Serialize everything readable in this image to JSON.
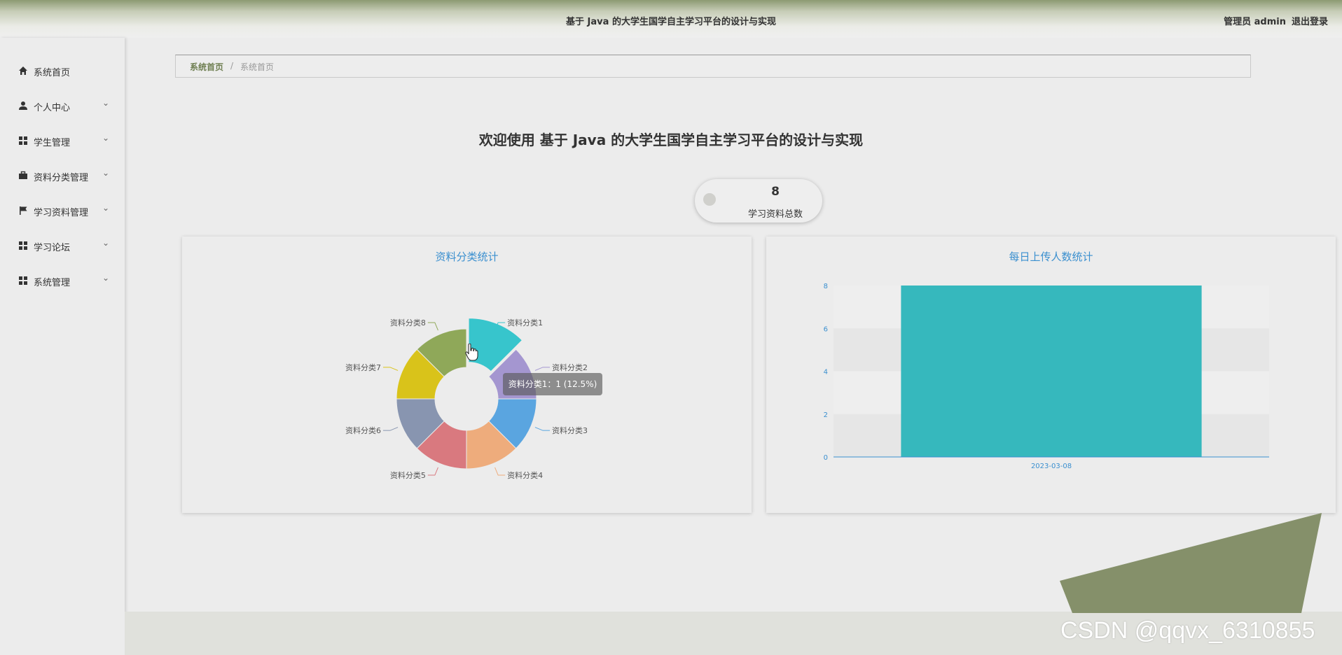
{
  "header": {
    "title": "基于 Java 的大学生国学自主学习平台的设计与实现",
    "user": "管理员 admin",
    "logout": "退出登录"
  },
  "sidebar": {
    "items": [
      {
        "label": "系统首页",
        "icon": "home-icon"
      },
      {
        "label": "个人中心",
        "icon": "user-icon"
      },
      {
        "label": "学生管理",
        "icon": "grid-icon"
      },
      {
        "label": "资料分类管理",
        "icon": "briefcase-icon"
      },
      {
        "label": "学习资料管理",
        "icon": "flag-icon"
      },
      {
        "label": "学习论坛",
        "icon": "grid-icon"
      },
      {
        "label": "系统管理",
        "icon": "grid-icon"
      }
    ]
  },
  "breadcrumb": {
    "home": "系统首页",
    "separator": "/",
    "current": "系统首页"
  },
  "welcome": "欢迎使用 基于 Java 的大学生国学自主学习平台的设计与实现",
  "stat": {
    "value": "8",
    "label": "学习资料总数"
  },
  "pie_panel": {
    "title": "资料分类统计"
  },
  "bar_panel": {
    "title": "每日上传人数统计"
  },
  "tooltip": "资料分类1：1 (12.5%)",
  "watermark": "CSDN @qqvx_6310855",
  "colors": {
    "accent": "#6f7f52",
    "title_blue": "#3a8fcf",
    "bar": "#36b8bd"
  },
  "chart_data": [
    {
      "type": "pie",
      "title": "资料分类统计",
      "donut": true,
      "categories": [
        "资料分类1",
        "资料分类2",
        "资料分类3",
        "资料分类4",
        "资料分类5",
        "资料分类6",
        "资料分类7",
        "资料分类8"
      ],
      "values": [
        1,
        1,
        1,
        1,
        1,
        1,
        1,
        1
      ],
      "colors": [
        "#37c5cc",
        "#a496d0",
        "#5aa5e0",
        "#eeac7c",
        "#d9797f",
        "#8895b0",
        "#d9c31a",
        "#8fa859"
      ],
      "highlighted": "资料分类1"
    },
    {
      "type": "bar",
      "title": "每日上传人数统计",
      "categories": [
        "2023-03-08"
      ],
      "values": [
        8
      ],
      "ylim": [
        0,
        8
      ],
      "yticks": [
        "0",
        "2",
        "4",
        "6",
        "8"
      ],
      "color": "#36b8bd"
    }
  ]
}
